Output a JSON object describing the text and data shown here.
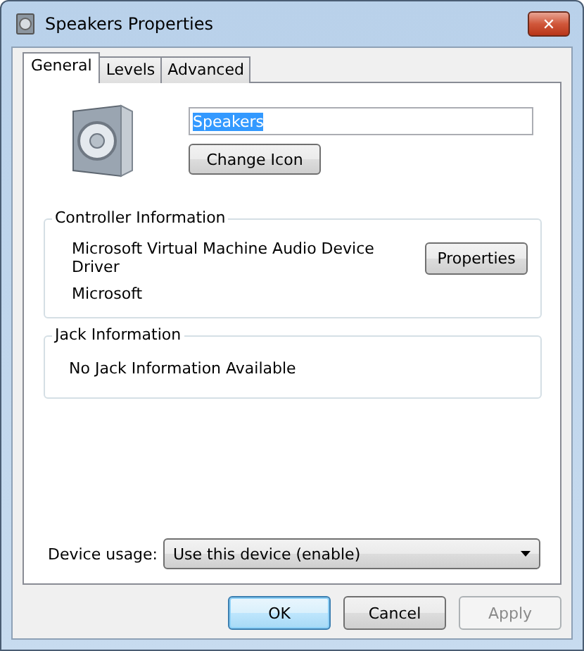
{
  "window": {
    "title": "Speakers Properties",
    "close": "✕"
  },
  "tabs": [
    {
      "label": "General",
      "selected": true
    },
    {
      "label": "Levels",
      "selected": false
    },
    {
      "label": "Advanced",
      "selected": false
    }
  ],
  "device": {
    "name": "Speakers",
    "name_selected": true,
    "change_icon_button": "Change Icon"
  },
  "controller_information": {
    "title": "Controller Information",
    "driver": "Microsoft Virtual Machine Audio Device Driver",
    "manufacturer": "Microsoft",
    "properties_button": "Properties"
  },
  "jack_information": {
    "title": "Jack Information",
    "text": "No Jack Information Available"
  },
  "device_usage": {
    "label": "Device usage:",
    "value": "Use this device (enable)"
  },
  "buttons": [
    {
      "label": "OK",
      "default": true,
      "disabled": false
    },
    {
      "label": "Cancel",
      "default": false,
      "disabled": false
    },
    {
      "label": "Apply",
      "default": false,
      "disabled": true
    }
  ]
}
